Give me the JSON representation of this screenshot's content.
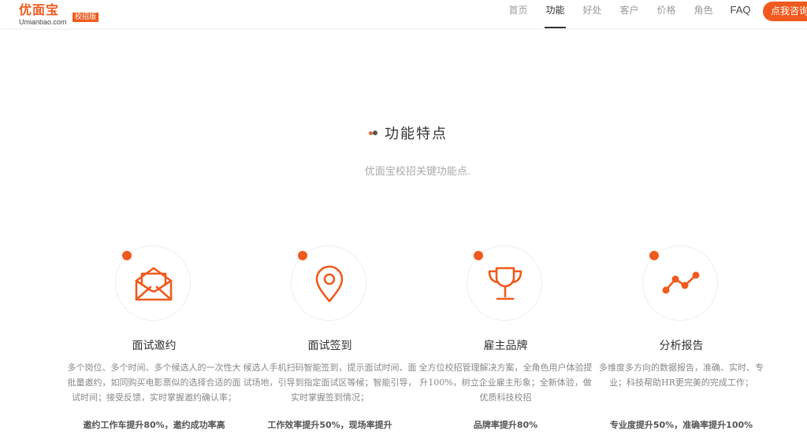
{
  "header": {
    "logo_cn": "优面宝",
    "logo_en": "Umianbao.com",
    "logo_badge": "校招版",
    "nav": [
      {
        "label": "首页",
        "active": false
      },
      {
        "label": "功能",
        "active": true
      },
      {
        "label": "好处",
        "active": false
      },
      {
        "label": "客户",
        "active": false
      },
      {
        "label": "价格",
        "active": false
      },
      {
        "label": "角色",
        "active": false
      },
      {
        "label": "FAQ",
        "active": false
      }
    ],
    "cta_label": "点我咨询"
  },
  "section": {
    "title": "功能特点",
    "subtitle": "优面宝校招关键功能点."
  },
  "features": [
    {
      "icon": "envelope-icon",
      "title": "面试邀约",
      "desc": "多个岗位、多个时间、多个候选人的一次性大批量邀约，如同购买电影票似的选择合适的面试时间；接受反馈，实时掌握邀约确认率；",
      "stat": "邀约工作车提升80%，邀约成功率高"
    },
    {
      "icon": "location-pin-icon",
      "title": "面试签到",
      "desc": "候选人手机扫码智能签到，提示面试时间、面试场地，引导到指定面试区等候；智能引导，实时掌握签到情况；",
      "stat": "工作效率提升50%，现场率提升"
    },
    {
      "icon": "trophy-icon",
      "title": "雇主品牌",
      "desc": "全方位校招管理解决方案，全角色用户体验提升100%，树立企业雇主形象；全新体验，做优质科技校招",
      "stat": "品牌率提升80%"
    },
    {
      "icon": "line-chart-icon",
      "title": "分析报告",
      "desc": "多维度多方向的数据报告，准确、实时、专业；科技帮助HR更完美的完成工作；",
      "stat": "专业度提升50%，准确率提升100%"
    }
  ],
  "colors": {
    "accent": "#f05a1e"
  }
}
